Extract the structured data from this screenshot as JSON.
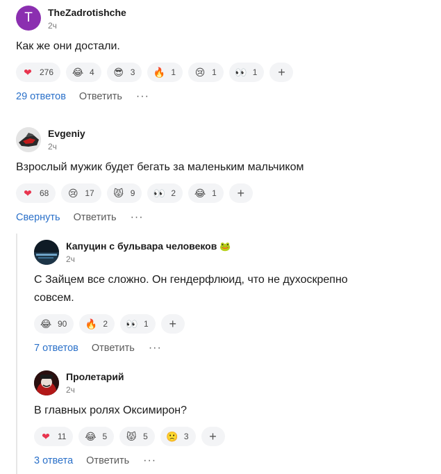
{
  "comments": [
    {
      "author": "TheZadrotishche",
      "avatar_letter": "T",
      "avatar_color": "#8b2fb0",
      "time": "2ч",
      "text": "Как же они достали.",
      "reactions": [
        {
          "icon": "heart-icon",
          "glyph": "❤",
          "count": "276"
        },
        {
          "icon": "laughing-tears-emoji-icon",
          "glyph": "😂",
          "count": "4"
        },
        {
          "icon": "sunglasses-emoji-icon",
          "glyph": "😎",
          "count": "3"
        },
        {
          "icon": "fire-emoji-icon",
          "glyph": "🔥",
          "count": "1"
        },
        {
          "icon": "sad-emoji-icon",
          "glyph": "😢",
          "count": "1"
        },
        {
          "icon": "eyes-emoji-icon",
          "glyph": "👀",
          "count": "1"
        }
      ],
      "replies_label": "29 ответов",
      "reply_label": "Ответить",
      "more_label": "···"
    },
    {
      "author": "Evgeniy",
      "time": "2ч",
      "text": "Взрослый мужик будет бегать за маленьким мальчиком",
      "reactions": [
        {
          "icon": "heart-icon",
          "glyph": "❤",
          "count": "68"
        },
        {
          "icon": "sad-emoji-icon",
          "glyph": "😢",
          "count": "17"
        },
        {
          "icon": "angry-pikachu-icon",
          "glyph": "😾",
          "count": "9"
        },
        {
          "icon": "eyes-emoji-icon",
          "glyph": "👀",
          "count": "2"
        },
        {
          "icon": "laughing-tears-emoji-icon",
          "glyph": "😂",
          "count": "1"
        }
      ],
      "replies_label": "Свернуть",
      "reply_label": "Ответить",
      "more_label": "···"
    },
    {
      "author": "Капуцин с бульвара человеков",
      "author_badge": "frog-emoji-icon",
      "time": "2ч",
      "text_lines": [
        "С Зайцем все сложно. Он гендерфлюид, что не духоскрепно",
        "совсем."
      ],
      "reactions": [
        {
          "icon": "laughing-tears-emoji-icon",
          "glyph": "😂",
          "count": "90"
        },
        {
          "icon": "fire-emoji-icon",
          "glyph": "🔥",
          "count": "2"
        },
        {
          "icon": "eyes-emoji-icon",
          "glyph": "👀",
          "count": "1"
        }
      ],
      "replies_label": "7 ответов",
      "reply_label": "Ответить",
      "more_label": "···"
    },
    {
      "author": "Пролетарий",
      "time": "2ч",
      "text": "В главных ролях Оксимирон?",
      "reactions": [
        {
          "icon": "heart-icon",
          "glyph": "❤",
          "count": "11"
        },
        {
          "icon": "laughing-tears-emoji-icon",
          "glyph": "😂",
          "count": "5"
        },
        {
          "icon": "angry-pikachu-icon",
          "glyph": "😾",
          "count": "5"
        },
        {
          "icon": "slight-frown-emoji-icon",
          "glyph": "🙁",
          "count": "3"
        }
      ],
      "replies_label": "3 ответа",
      "reply_label": "Ответить",
      "more_label": "···"
    }
  ],
  "add_reaction_glyph": "+"
}
